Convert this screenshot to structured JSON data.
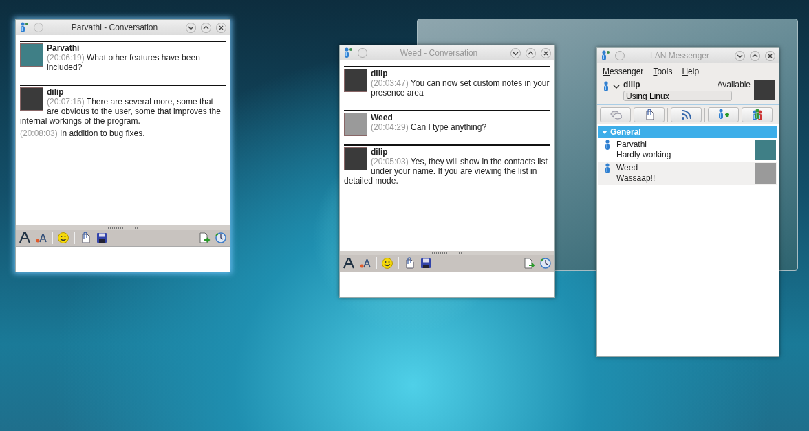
{
  "windows": [
    {
      "kind": "conversation",
      "title": "Parvathi - Conversation",
      "active": true,
      "messages": [
        {
          "sender": "Parvathi",
          "color": "#3f7f86",
          "entries": [
            {
              "time": "(20:06:19)",
              "text": "What other features have been included?"
            }
          ]
        },
        {
          "sender": "dilip",
          "color": "#3a3a3a",
          "entries": [
            {
              "time": "(20:07:15)",
              "text": "There are several more, some that are obvious to the user, some that improves the internal workings of the program."
            },
            {
              "time": "(20:08:03)",
              "text": "In addition to bug fixes."
            }
          ]
        }
      ]
    },
    {
      "kind": "conversation",
      "title": "Weed - Conversation",
      "active": false,
      "messages": [
        {
          "sender": "dilip",
          "color": "#3a3a3a",
          "entries": [
            {
              "time": "(20:03:47)",
              "text": "You can now set custom notes in your presence area"
            }
          ]
        },
        {
          "sender": "Weed",
          "color": "#9a9a9a",
          "entries": [
            {
              "time": "(20:04:29)",
              "text": "Can I type anything?"
            }
          ]
        },
        {
          "sender": "dilip",
          "color": "#3a3a3a",
          "entries": [
            {
              "time": "(20:05:03)",
              "text": "Yes, they will show in the contacts list under your name. If you are viewing the list in detailed mode."
            }
          ]
        }
      ]
    },
    {
      "kind": "messenger",
      "title": "LAN Messenger",
      "active": false,
      "menu": [
        "Messenger",
        "Tools",
        "Help"
      ],
      "user": {
        "name": "dilip",
        "status": "Available",
        "note": "Using Linux",
        "color": "#3a3a3a"
      },
      "groups": [
        {
          "name": "General",
          "expanded": true,
          "contacts": [
            {
              "name": "Parvathi",
              "note": "Hardly working",
              "color": "#3f7f86"
            },
            {
              "name": "Weed",
              "note": "Wassaap!!",
              "color": "#9a9a9a"
            }
          ]
        }
      ]
    }
  ]
}
